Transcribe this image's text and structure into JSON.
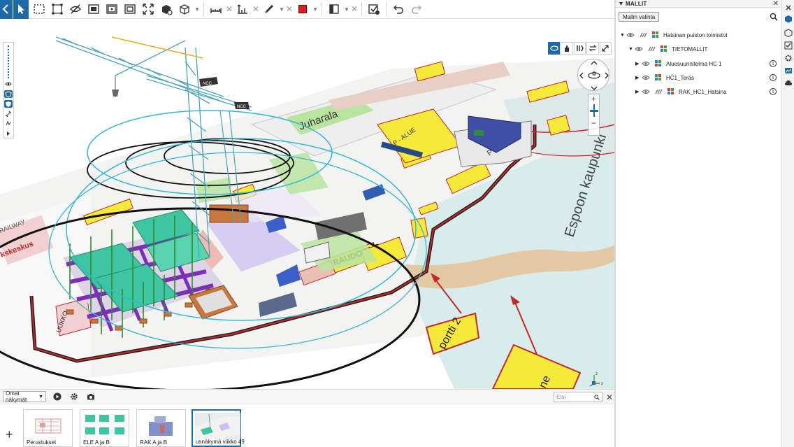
{
  "toolbar": {
    "icons": [
      "back-icon",
      "select-pointer-icon",
      "box-select-icon",
      "axis-icon",
      "hide-icon",
      "section-box-icon",
      "frame-icon",
      "fit-view-icon",
      "expand-icon",
      "objects-icon",
      "cube-view-icon",
      "measure-icon",
      "measure-height-icon",
      "markup-pen-icon",
      "color-swatch",
      "section-plane-icon",
      "issue-check-icon",
      "undo-icon",
      "redo-icon"
    ],
    "markup_color": "#d81e1e"
  },
  "viewport": {
    "scene_labels": {
      "road": "Juharala",
      "p_alue_1": "P - ALUE",
      "p_alue_2": "P - ALUE",
      "espoon": "Espoon kaupunki",
      "raudoitus": "RAUDOITUS",
      "portti": "portti 2",
      "railway": "RAILWAY",
      "keskus": "kskeskus",
      "ukko": "UUKKO",
      "crane_tag_1": "NCC",
      "crane_tag_2": "NCC",
      "sign_bottom": "ne"
    },
    "accent": "#1c6aa8"
  },
  "bottom_bar": {
    "views_select": "Omat näkymät",
    "search_placeholder": "Etsi"
  },
  "thumbnails": [
    {
      "label": "Perustukset"
    },
    {
      "label": "ELE A ja B"
    },
    {
      "label": "RAK A ja B"
    },
    {
      "label": "usnäkymä viikko 49"
    }
  ],
  "right_panel": {
    "title": "MALLIT",
    "model_select_label": "Mallin valinta",
    "tree": [
      {
        "label": "Hatsinan puiston toimistot",
        "level": 0,
        "expanded": true
      },
      {
        "label": "TIETOMALLIT",
        "level": 1,
        "expanded": true
      },
      {
        "label": "Aluesuunnitelma HC 1",
        "level": 2,
        "expanded": false,
        "info": "i"
      },
      {
        "label": "HC1_Teräs",
        "level": 2,
        "expanded": false,
        "info": "i"
      },
      {
        "label": "RAK_HC1_Hatsina",
        "level": 2,
        "expanded": false,
        "info": "i"
      }
    ]
  }
}
